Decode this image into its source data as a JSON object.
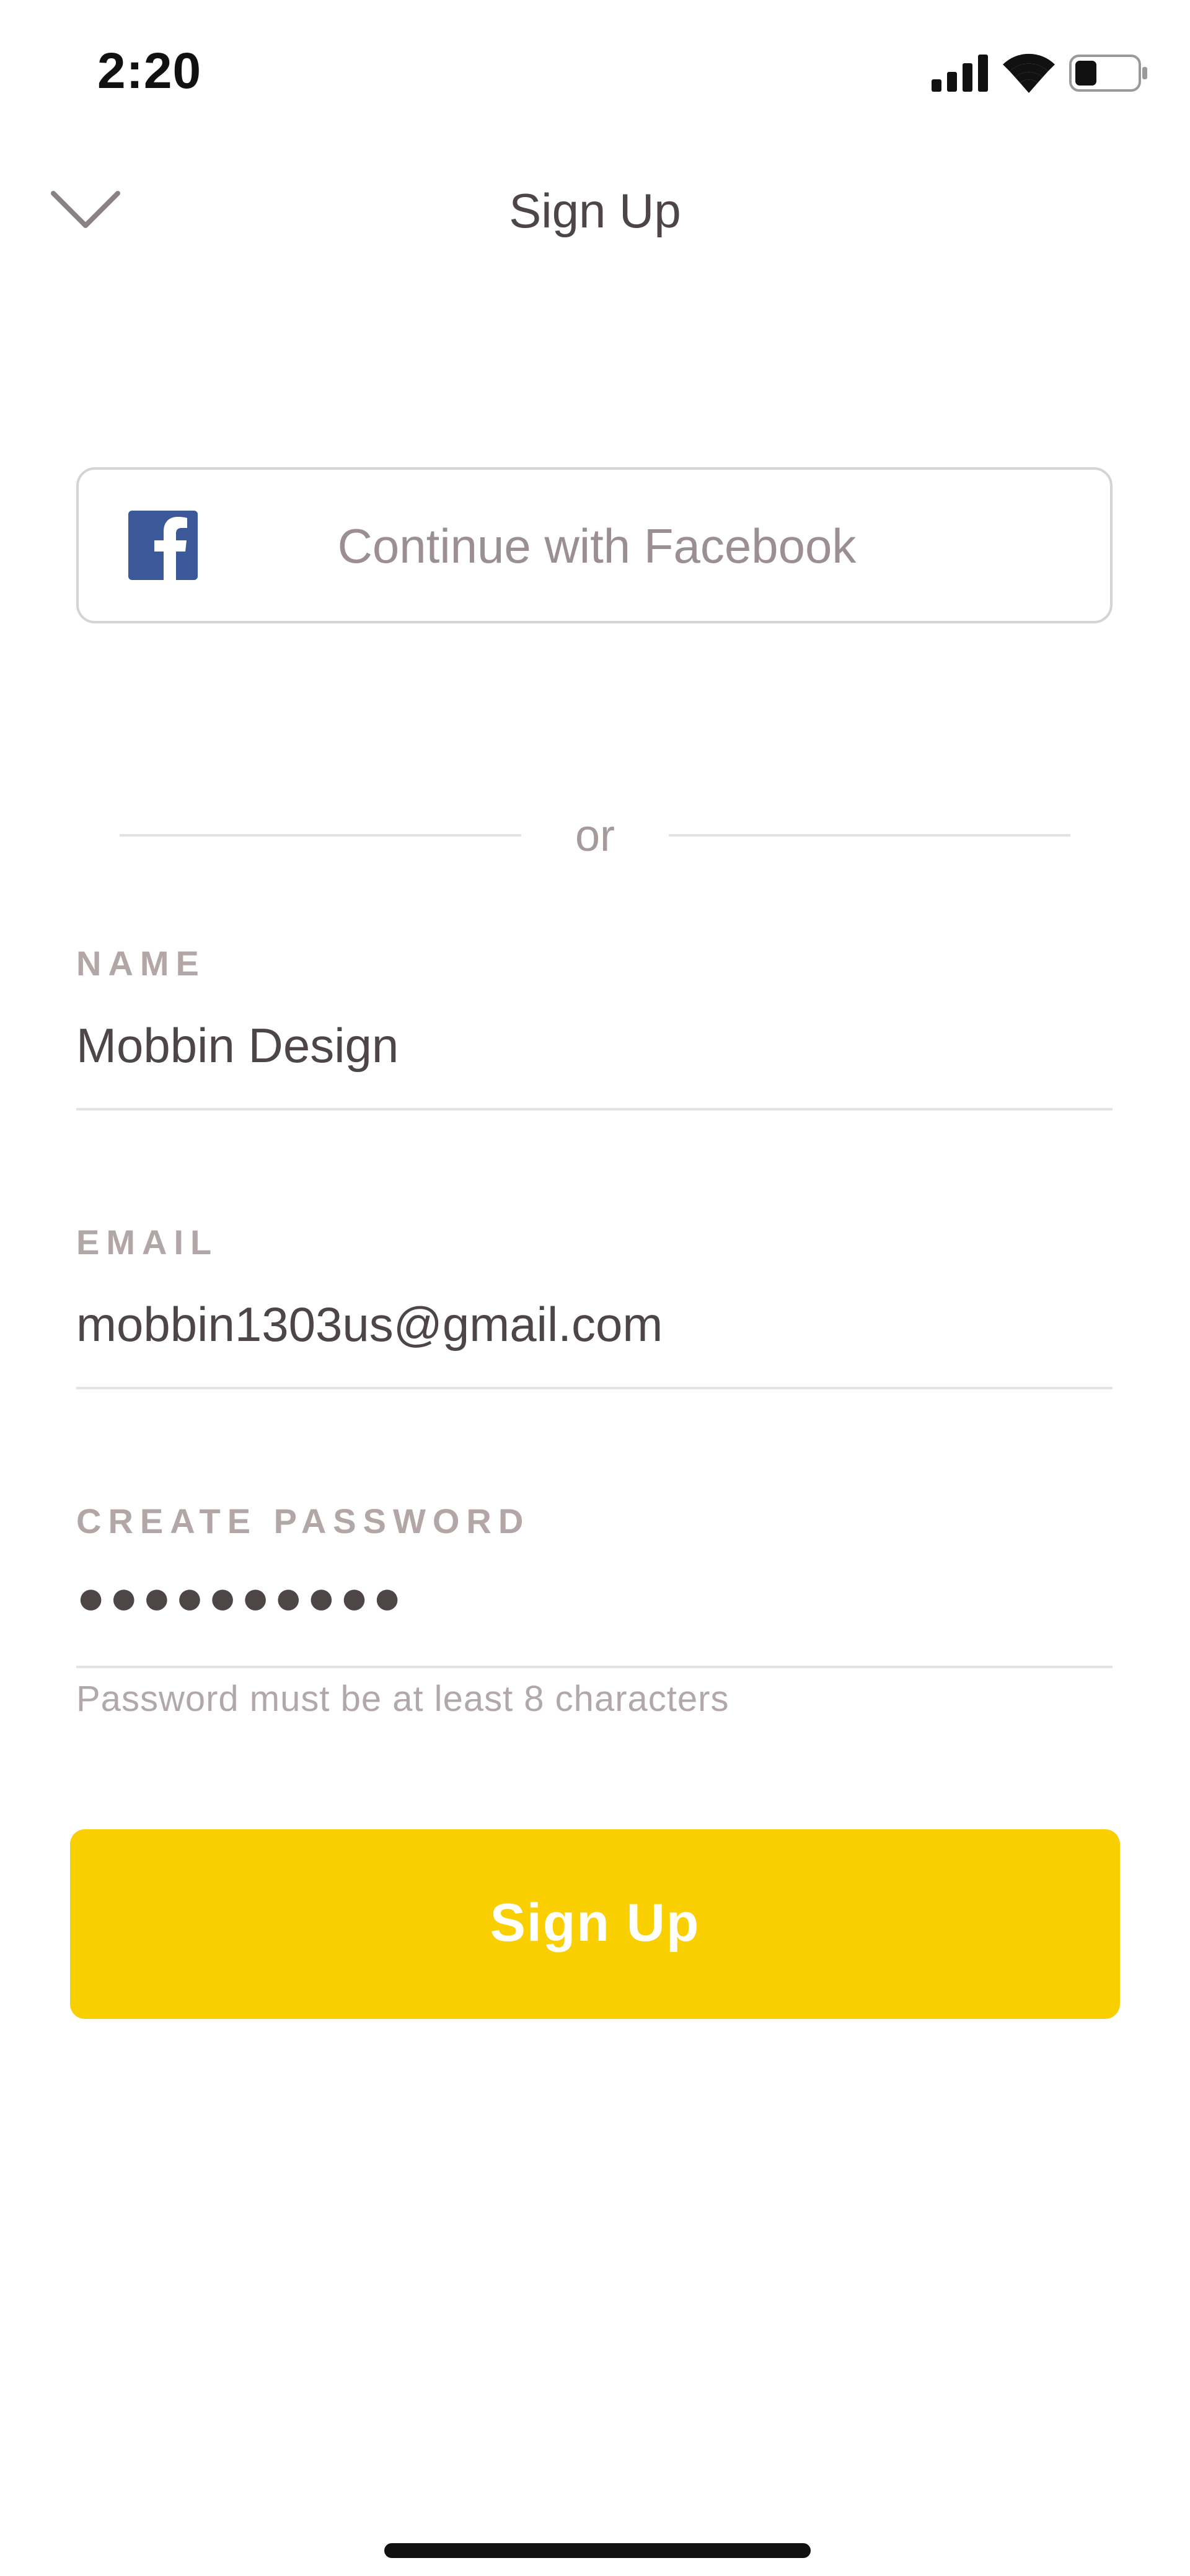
{
  "status_bar": {
    "time": "2:20",
    "signal_icon": "cellular-signal-icon",
    "wifi_icon": "wifi-icon",
    "battery_icon": "battery-icon",
    "battery_level": 0.35
  },
  "nav": {
    "back_icon": "chevron-down-icon",
    "title": "Sign Up"
  },
  "facebook": {
    "icon": "facebook-icon",
    "label": "Continue with Facebook",
    "brand_color": "#3b5998"
  },
  "divider": {
    "label": "or"
  },
  "form": {
    "name": {
      "label": "NAME",
      "value": "Mobbin Design"
    },
    "email": {
      "label": "EMAIL",
      "value": "mobbin1303us@gmail.com"
    },
    "password": {
      "label": "CREATE PASSWORD",
      "masked_value": "●●●●●●●●●●",
      "hint": "Password must be at least 8 characters"
    }
  },
  "submit": {
    "label": "Sign Up",
    "color": "#f9cf00"
  },
  "colors": {
    "text_primary": "#4e4546",
    "text_muted": "#b2a6a7",
    "divider": "#e4e1e2"
  }
}
